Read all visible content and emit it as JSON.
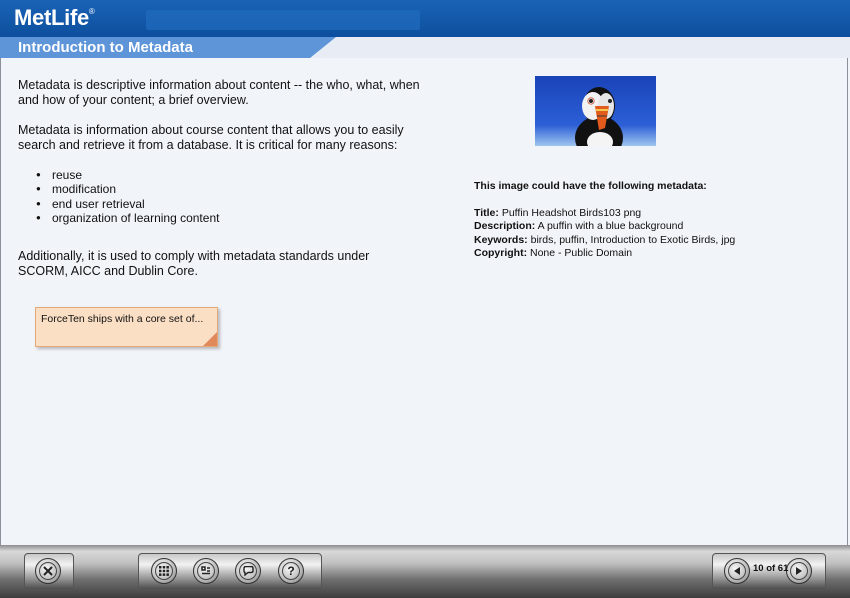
{
  "header": {
    "logo": "MetLife",
    "logo_mark": "®"
  },
  "lesson": {
    "title": "Introduction to Metadata"
  },
  "content": {
    "paragraph1": "Metadata is descriptive information about content -- the who, what, when and how of your content; a brief overview.",
    "paragraph2": "Metadata is information about course content that allows you to easily search and retrieve it from a database. It is critical for many reasons:",
    "bullets": [
      "reuse",
      "modification",
      "end user retrieval",
      "organization of learning content"
    ],
    "paragraph3": "Additionally, it is used to comply with metadata standards under SCORM, AICC and Dublin Core.",
    "note": "ForceTen ships with a core set of..."
  },
  "image_meta": {
    "heading": "This image could have the following metadata:",
    "title_label": "Title:",
    "title_value": "Puffin Headshot Birds103 png",
    "description_label": "Description:",
    "description_value": "A puffin with a blue background",
    "keywords_label": "Keywords:",
    "keywords_value": "birds, puffin, Introduction to Exotic Birds, jpg",
    "copyright_label": "Copyright:",
    "copyright_value": "None - Public Domain"
  },
  "toolbar": {
    "exit_icon": "close-icon",
    "menu_icon": "grid-menu-icon",
    "index_icon": "index-icon",
    "glossary_icon": "speech-bubble-icon",
    "help_icon": "question-icon",
    "help_label": "?",
    "prev_icon": "left-arrow-icon",
    "next_icon": "right-arrow-icon",
    "page_indicator": "10 of 61"
  },
  "colors": {
    "header_blue": "#0d4f9e",
    "title_tab": "#5e95d8",
    "note_bg": "#fbdfc5"
  }
}
